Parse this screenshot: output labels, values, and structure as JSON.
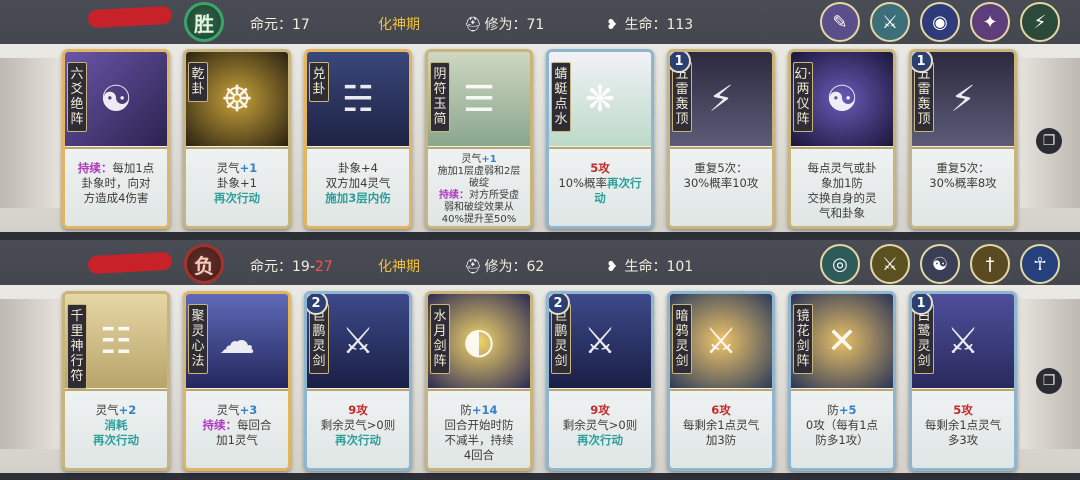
{
  "players": [
    {
      "result": "胜",
      "life_label": "命元：",
      "life_value": "17",
      "life_max": "",
      "realm": "化神期",
      "cultivation_label": "修为：",
      "cultivation_value": "71",
      "hp_label": "生命：",
      "hp_value": "113",
      "skill_icons": [
        "scroll-icon",
        "sword-rain-icon",
        "spirit-orb-icon",
        "sorceress-icon",
        "thunder-icon"
      ],
      "cards": [
        {
          "name": "六爻绝阵",
          "level": "",
          "lines": [
            [
              "持续：",
              "purple",
              "每加1点"
            ],
            [
              "卦象时，向对",
              "",
              ""
            ],
            [
              "方造成4伤害",
              "",
              ""
            ]
          ]
        },
        {
          "name": "乾卦",
          "level": "",
          "lines": [
            [
              "灵气",
              "",
              "+1"
            ],
            [
              "卦象+1",
              "",
              ""
            ],
            [
              "再次行动",
              "teal",
              ""
            ]
          ]
        },
        {
          "name": "兑卦",
          "level": "",
          "lines": [
            [
              "卦象+4",
              "",
              ""
            ],
            [
              "双方加4灵气",
              "",
              ""
            ],
            [
              "施加3层内伤",
              "teal",
              ""
            ]
          ]
        },
        {
          "name": "阴符玉简",
          "level": "",
          "lines": [
            [
              "灵气",
              "",
              "+1"
            ],
            [
              "施加1层虚弱和2层",
              "",
              ""
            ],
            [
              "破绽",
              "",
              ""
            ],
            [
              "持续：",
              "purple",
              "对方所受虚"
            ],
            [
              "弱和破绽效果从",
              "",
              ""
            ],
            [
              "40%提升至50%",
              "",
              ""
            ]
          ]
        },
        {
          "name": "蜻蜓点水",
          "level": "",
          "lines": [
            [
              "5攻",
              "red",
              ""
            ],
            [
              "10%概率",
              "",
              "再次行"
            ],
            [
              "动",
              "teal",
              ""
            ]
          ]
        },
        {
          "name": "五雷轰顶",
          "level": "1",
          "lines": [
            [
              "重复5次：",
              "",
              ""
            ],
            [
              "30%概率10攻",
              "",
              ""
            ]
          ]
        },
        {
          "name": "幻·两仪阵",
          "level": "",
          "lines": [
            [
              "每点灵气或卦",
              "",
              ""
            ],
            [
              "象加1防",
              "",
              ""
            ],
            [
              "交换自身的灵",
              "",
              ""
            ],
            [
              "气和卦象",
              "",
              ""
            ]
          ]
        },
        {
          "name": "五雷轰顶",
          "level": "1",
          "lines": [
            [
              "重复5次：",
              "",
              ""
            ],
            [
              "30%概率8攻",
              "",
              ""
            ]
          ]
        }
      ]
    },
    {
      "result": "负",
      "life_label": "命元：",
      "life_value": "19",
      "life_max": "27",
      "realm": "化神期",
      "cultivation_label": "修为：",
      "cultivation_value": "62",
      "hp_label": "生命：",
      "hp_value": "101",
      "skill_icons": [
        "eye-icon",
        "sword-volley-icon",
        "yin-yang-icon",
        "spear-icon",
        "meditating-figure-icon"
      ],
      "cards": [
        {
          "name": "千里神行符",
          "level": "",
          "lines": [
            [
              "灵气",
              "",
              "+2"
            ],
            [
              "消耗",
              "teal",
              ""
            ],
            [
              "再次行动",
              "teal",
              ""
            ]
          ]
        },
        {
          "name": "聚灵心法",
          "level": "",
          "lines": [
            [
              "灵气",
              "",
              "+3"
            ],
            [
              "持续：",
              "purple",
              "每回合"
            ],
            [
              "加1灵气",
              "",
              ""
            ]
          ]
        },
        {
          "name": "巨鹏灵剑",
          "level": "2",
          "lines": [
            [
              "9攻",
              "red",
              ""
            ],
            [
              "剩余灵气>0则",
              "",
              ""
            ],
            [
              "再次行动",
              "teal",
              ""
            ]
          ]
        },
        {
          "name": "水月剑阵",
          "level": "",
          "lines": [
            [
              "防",
              "",
              "+14"
            ],
            [
              "回合开始时防",
              "",
              ""
            ],
            [
              "不减半，持续",
              "",
              ""
            ],
            [
              "4回合",
              "",
              ""
            ]
          ]
        },
        {
          "name": "巨鹏灵剑",
          "level": "2",
          "lines": [
            [
              "9攻",
              "red",
              ""
            ],
            [
              "剩余灵气>0则",
              "",
              ""
            ],
            [
              "再次行动",
              "teal",
              ""
            ]
          ]
        },
        {
          "name": "暗鸦灵剑",
          "level": "",
          "lines": [
            [
              "6攻",
              "red",
              ""
            ],
            [
              "每剩余1点灵气",
              "",
              ""
            ],
            [
              "加3防",
              "",
              ""
            ]
          ]
        },
        {
          "name": "镜花剑阵",
          "level": "",
          "lines": [
            [
              "防",
              "",
              "+5"
            ],
            [
              "0攻（每有1点",
              "",
              ""
            ],
            [
              "防多1攻）",
              "",
              ""
            ]
          ]
        },
        {
          "name": "白鹭灵剑",
          "level": "1",
          "lines": [
            [
              "5攻",
              "red",
              ""
            ],
            [
              "每剩余1点灵气",
              "",
              ""
            ],
            [
              "多3攻",
              "",
              ""
            ]
          ]
        }
      ]
    }
  ],
  "colors": {
    "realm": "#efc23b",
    "life_max": "#ff4d4d",
    "keyword_persist": "#b13cc0",
    "keyword_action": "#2c9f9a",
    "attack": "#c42b2b",
    "plus_value": "#3a7fc9"
  }
}
